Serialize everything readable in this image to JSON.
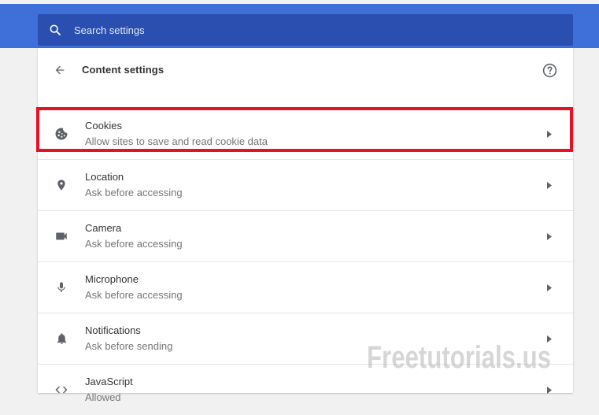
{
  "search": {
    "placeholder": "Search settings",
    "icon": "search-icon"
  },
  "header": {
    "title": "Content settings",
    "back_icon": "arrow-back-icon",
    "help_icon": "help-icon"
  },
  "rows": [
    {
      "title": "Cookies",
      "subtitle": "Allow sites to save and read cookie data",
      "icon": "cookie-icon",
      "highlighted": true
    },
    {
      "title": "Location",
      "subtitle": "Ask before accessing",
      "icon": "location-pin-icon"
    },
    {
      "title": "Camera",
      "subtitle": "Ask before accessing",
      "icon": "camera-icon"
    },
    {
      "title": "Microphone",
      "subtitle": "Ask before accessing",
      "icon": "microphone-icon"
    },
    {
      "title": "Notifications",
      "subtitle": "Ask before sending",
      "icon": "bell-icon"
    },
    {
      "title": "JavaScript",
      "subtitle": "Allowed",
      "icon": "code-icon"
    }
  ],
  "watermark": "Freetutorials.us",
  "colors": {
    "header_blue": "#3f6fd8",
    "search_blue": "#2a4fb0",
    "highlight_red": "#e81123",
    "icon_gray": "#5f6368"
  }
}
